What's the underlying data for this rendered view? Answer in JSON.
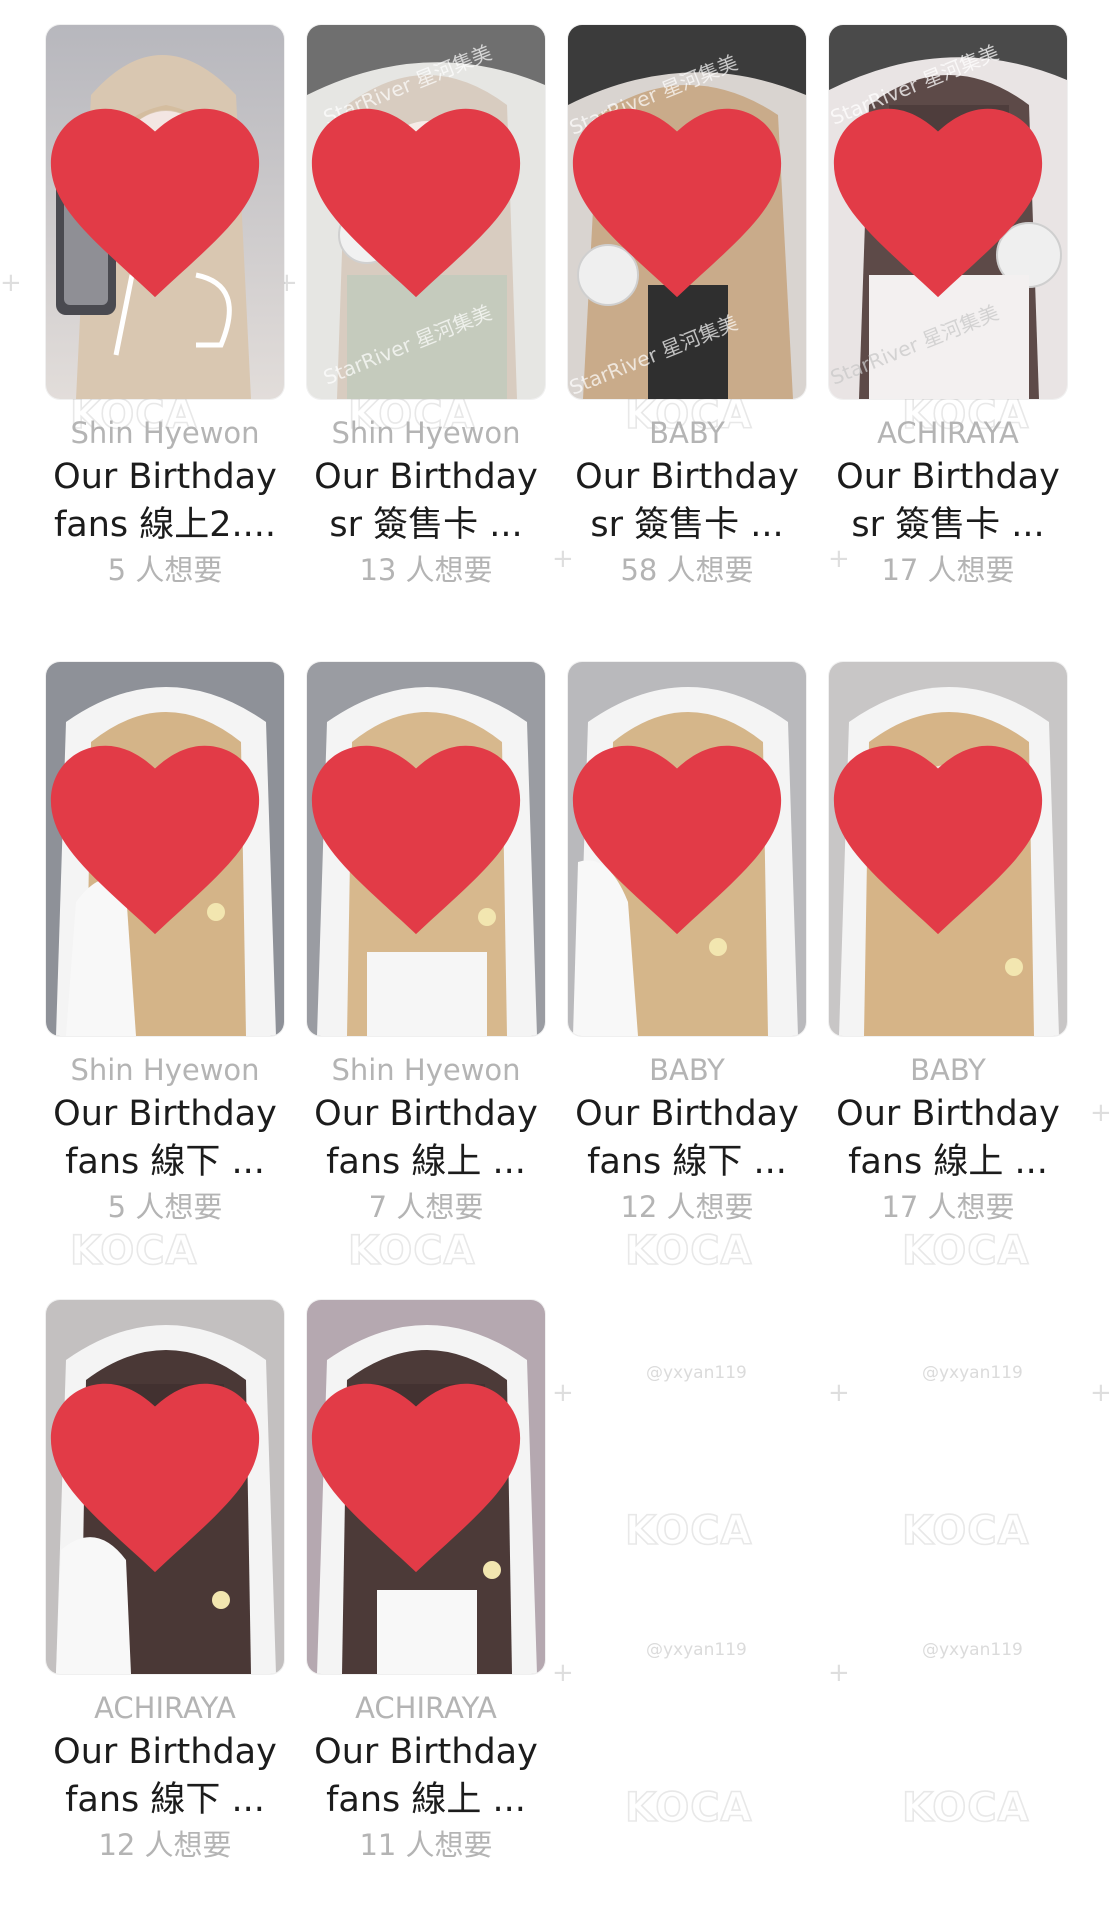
{
  "colors": {
    "heart": "#e23b47",
    "member_text": "#b4b4b4",
    "title_text": "#1c1c1c",
    "want_text": "#b4b4b4"
  },
  "watermarks": {
    "brand": "KOCA",
    "user": "@yxyan119",
    "photo_brand": "StarRiver 星河集美"
  },
  "cards": [
    {
      "member": "Shin Hyewon",
      "title_line1": "Our Birthday",
      "title_line2": "fans 線上2....",
      "want": "5 人想要",
      "icon": "heart-icon"
    },
    {
      "member": "Shin Hyewon",
      "title_line1": "Our Birthday",
      "title_line2": "sr 簽售卡 ...",
      "want": "13 人想要",
      "icon": "heart-icon"
    },
    {
      "member": "BABY",
      "title_line1": "Our Birthday",
      "title_line2": "sr 簽售卡 ...",
      "want": "58 人想要",
      "icon": "heart-icon"
    },
    {
      "member": "ACHIRAYA",
      "title_line1": "Our Birthday",
      "title_line2": "sr 簽售卡 ...",
      "want": "17 人想要",
      "icon": "heart-icon"
    },
    {
      "member": "Shin Hyewon",
      "title_line1": "Our Birthday",
      "title_line2": "fans 線下 ...",
      "want": "5 人想要",
      "icon": "heart-icon"
    },
    {
      "member": "Shin Hyewon",
      "title_line1": "Our Birthday",
      "title_line2": "fans 線上 ...",
      "want": "7 人想要",
      "icon": "heart-icon"
    },
    {
      "member": "BABY",
      "title_line1": "Our Birthday",
      "title_line2": "fans 線下 ...",
      "want": "12 人想要",
      "icon": "heart-icon"
    },
    {
      "member": "BABY",
      "title_line1": "Our Birthday",
      "title_line2": "fans 線上 ...",
      "want": "17 人想要",
      "icon": "heart-icon"
    },
    {
      "member": "ACHIRAYA",
      "title_line1": "Our Birthday",
      "title_line2": "fans 線下 ...",
      "want": "12 人想要",
      "icon": "heart-icon"
    },
    {
      "member": "ACHIRAYA",
      "title_line1": "Our Birthday",
      "title_line2": "fans 線上 ...",
      "want": "11 人想要",
      "icon": "heart-icon"
    }
  ]
}
